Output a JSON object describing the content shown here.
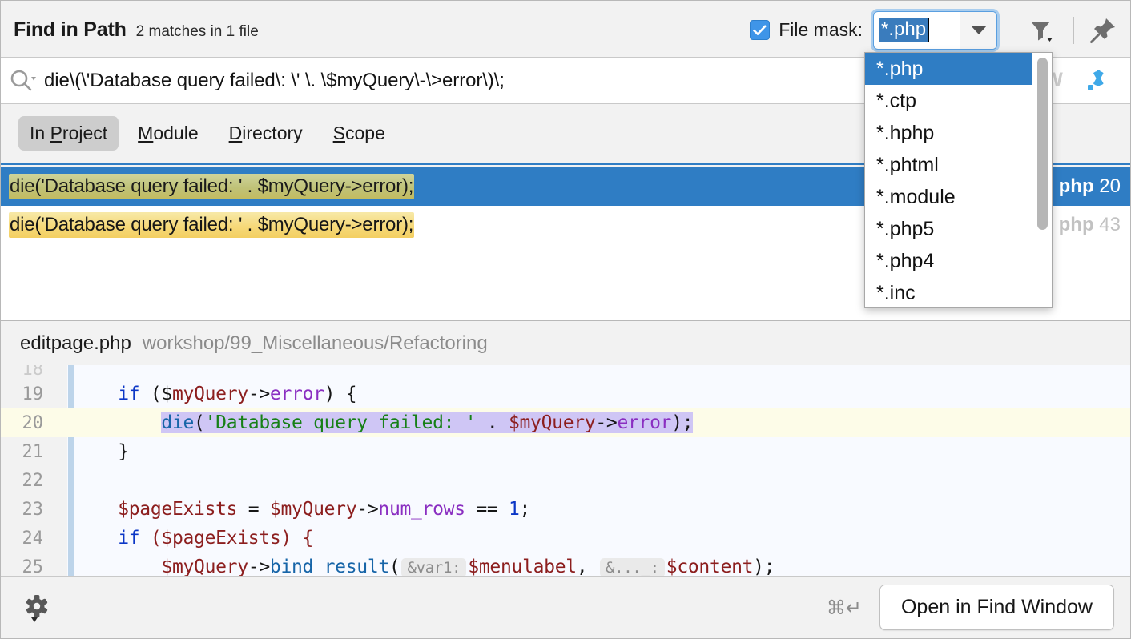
{
  "header": {
    "title": "Find in Path",
    "match_summary": "2 matches in 1 file",
    "file_mask_label": "File mask:",
    "file_mask_value": "*.php",
    "file_mask_checked": true,
    "filter_icon": "filter-funnel-icon",
    "pin_icon": "pin-icon"
  },
  "search": {
    "query": "die\\(\\'Database query failed\\: \\' \\. \\$myQuery\\-\\>error\\)\\;",
    "search_icon": "magnifier-icon",
    "option_words": "W",
    "option_regex": ".*"
  },
  "scope_tabs": [
    {
      "pre": "In ",
      "mnemonic": "P",
      "post": "roject",
      "selected": true
    },
    {
      "pre": "",
      "mnemonic": "M",
      "post": "odule",
      "selected": false
    },
    {
      "pre": "",
      "mnemonic": "D",
      "post": "irectory",
      "selected": false
    },
    {
      "pre": "",
      "mnemonic": "S",
      "post": "cope",
      "selected": false
    }
  ],
  "file_mask_options": [
    {
      "label": "*.php",
      "selected": true
    },
    {
      "label": "*.ctp",
      "selected": false
    },
    {
      "label": "*.hphp",
      "selected": false
    },
    {
      "label": "*.phtml",
      "selected": false
    },
    {
      "label": "*.module",
      "selected": false
    },
    {
      "label": "*.php5",
      "selected": false
    },
    {
      "label": "*.php4",
      "selected": false
    },
    {
      "label": "*.inc",
      "selected": false
    }
  ],
  "results": [
    {
      "match_text": "die('Database query failed: ' . $myQuery->error);",
      "file": "php",
      "line": "20",
      "selected": true
    },
    {
      "match_text": "die('Database query failed: ' . $myQuery->error);",
      "file": "php",
      "line": "43",
      "selected": false
    }
  ],
  "preview": {
    "file_name": "editpage.php",
    "file_path": "workshop/99_Miscellaneous/Refactoring",
    "lines": [
      {
        "num": "18",
        "partial": true,
        "highlight": false
      },
      {
        "num": "19",
        "partial": false,
        "highlight": false
      },
      {
        "num": "20",
        "partial": false,
        "highlight": true
      },
      {
        "num": "21",
        "partial": false,
        "highlight": false
      },
      {
        "num": "22",
        "partial": false,
        "highlight": false
      },
      {
        "num": "23",
        "partial": false,
        "highlight": false
      },
      {
        "num": "24",
        "partial": false,
        "highlight": false
      },
      {
        "num": "25",
        "partial": false,
        "highlight": false
      }
    ],
    "code": {
      "l19_if": "if",
      "l19_open": " ($",
      "l19_var": "myQuery",
      "l19_arrow": "->",
      "l19_prop": "error",
      "l19_close": ") {",
      "l20_fn": "die",
      "l20_paren": "(",
      "l20_str": "'Database query failed: '",
      "l20_concat": " . ",
      "l20_var": "$myQuery",
      "l20_arrow": "->",
      "l20_prop": "error",
      "l20_end": ");",
      "l21": "}",
      "l23_var": "$pageExists",
      "l23_eq": " = ",
      "l23_var2": "$myQuery",
      "l23_arrow": "->",
      "l23_prop": "num_rows",
      "l23_cmp": " == ",
      "l23_num": "1",
      "l23_semi": ";",
      "l24_if": "if",
      "l24_rest": " ($pageExists) {",
      "l25_var": "$myQuery",
      "l25_arrow": "->",
      "l25_fn": "bind_result",
      "l25_open": "(",
      "l25_hint1": "&var1:",
      "l25_arg1": "$menulabel",
      "l25_comma": ",",
      "l25_hint2": "&..._:",
      "l25_arg2": "$content",
      "l25_end": ");"
    }
  },
  "bottom": {
    "settings_icon": "gear-icon",
    "shortcut": "⌘↵",
    "open_button": "Open in Find Window"
  },
  "colors": {
    "accent_blue": "#2f7dc4",
    "highlight_yellow": "#f6d97a",
    "selected_code": "#cfc6f5",
    "regex_active": "#3fa9e8"
  }
}
